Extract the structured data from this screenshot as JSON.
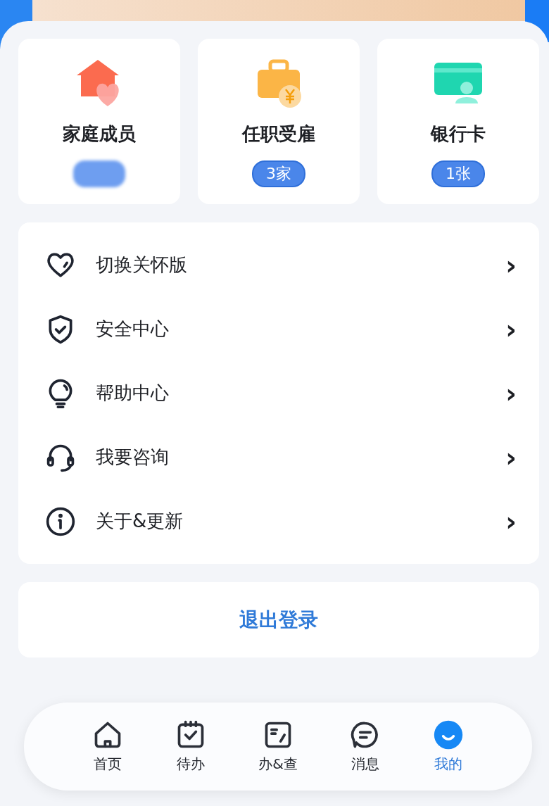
{
  "cards": [
    {
      "title": "家庭成员",
      "badge": {
        "kind": "blurred"
      }
    },
    {
      "title": "任职受雇",
      "badge": {
        "kind": "count",
        "text": "3家"
      }
    },
    {
      "title": "银行卡",
      "badge": {
        "kind": "count",
        "text": "1张"
      }
    }
  ],
  "menu": [
    {
      "label": "切换关怀版",
      "arrow": "›"
    },
    {
      "label": "安全中心",
      "arrow": "›"
    },
    {
      "label": "帮助中心",
      "arrow": "›"
    },
    {
      "label": "我要咨询",
      "arrow": "›"
    },
    {
      "label": "关于&更新",
      "arrow": "›"
    }
  ],
  "logout": "退出登录",
  "nav": [
    {
      "label": "首页",
      "selected": false
    },
    {
      "label": "待办",
      "selected": false
    },
    {
      "label": "办&查",
      "selected": false
    },
    {
      "label": "消息",
      "selected": false
    },
    {
      "label": "我的",
      "selected": true
    }
  ]
}
